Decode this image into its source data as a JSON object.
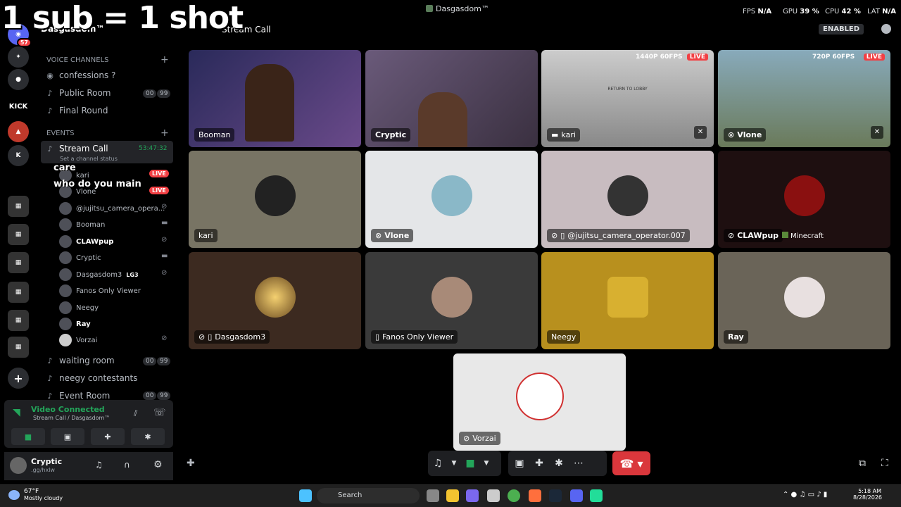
{
  "overlay": {
    "text": "1 sub = 1 shot"
  },
  "titlebar": {
    "title": "Dasgasdom™",
    "fps_label": "FPS",
    "fps_value": "N/A",
    "gpu_label": "GPU",
    "gpu_value": "39 %",
    "cpu_label": "CPU",
    "cpu_value": "42 %",
    "lat_label": "LAT",
    "lat_value": "N/A"
  },
  "rail": {
    "badge": "57"
  },
  "sidebar": {
    "server_name": "Dasgasdom™",
    "voice_category": "VOICE CHANNELS",
    "events_category": "EVENTS",
    "channels": [
      {
        "label": "confessions ?"
      },
      {
        "label": "Public Room",
        "count": "00",
        "limit": "99"
      },
      {
        "label": "Final Round"
      }
    ],
    "active_channel": "Stream Call",
    "timer": "53:47:32",
    "status_hint": "Set a channel status",
    "members": [
      {
        "name": "kari",
        "live": "LIVE"
      },
      {
        "name": "Vlone",
        "live": "LIVE"
      },
      {
        "name": "@jujitsu_camera_opera..."
      },
      {
        "name": "Booman"
      },
      {
        "name": "CLAWpup"
      },
      {
        "name": "Cryptic"
      },
      {
        "name": "Dasgasdom3",
        "tag": "LG3"
      },
      {
        "name": "Fanos Only Viewer"
      },
      {
        "name": "Neegy"
      },
      {
        "name": "Ray"
      },
      {
        "name": "Vorzai"
      }
    ],
    "lower_channels": [
      {
        "label": "waiting room",
        "count": "00",
        "limit": "99"
      },
      {
        "label": "neegy contestants"
      },
      {
        "label": "Event Room",
        "count": "00",
        "limit": "99"
      }
    ],
    "chat_overlay": [
      "care",
      "who do you main"
    ]
  },
  "voice_panel": {
    "title": "Video Connected",
    "subtitle": "Stream Call / Dasgasdom™"
  },
  "user_panel": {
    "name": "Cryptic",
    "status": ".gg/hxlw"
  },
  "header": {
    "channel": "Stream Call",
    "enabled": "ENABLED"
  },
  "tiles": [
    {
      "name": "Booman"
    },
    {
      "name": "Cryptic"
    },
    {
      "name": "kari",
      "quality": "1440P 60FPS",
      "live": "LIVE",
      "stream_text": "RETURN TO LOBBY"
    },
    {
      "name": "Vlone",
      "quality": "720P 60FPS",
      "live": "LIVE"
    },
    {
      "name": "kari"
    },
    {
      "name": "Vlone"
    },
    {
      "name": "@jujitsu_camera_operator.007"
    },
    {
      "name": "CLAWpup",
      "game": "Minecraft"
    },
    {
      "name": "Dasgasdom3"
    },
    {
      "name": "Fanos Only Viewer"
    },
    {
      "name": "Neegy"
    },
    {
      "name": "Ray"
    },
    {
      "name": "Vorzai"
    }
  ],
  "taskbar": {
    "temp": "67°F",
    "weather": "Mostly cloudy",
    "search": "Search",
    "time": "5:18 AM",
    "date": "8/28/2026"
  }
}
